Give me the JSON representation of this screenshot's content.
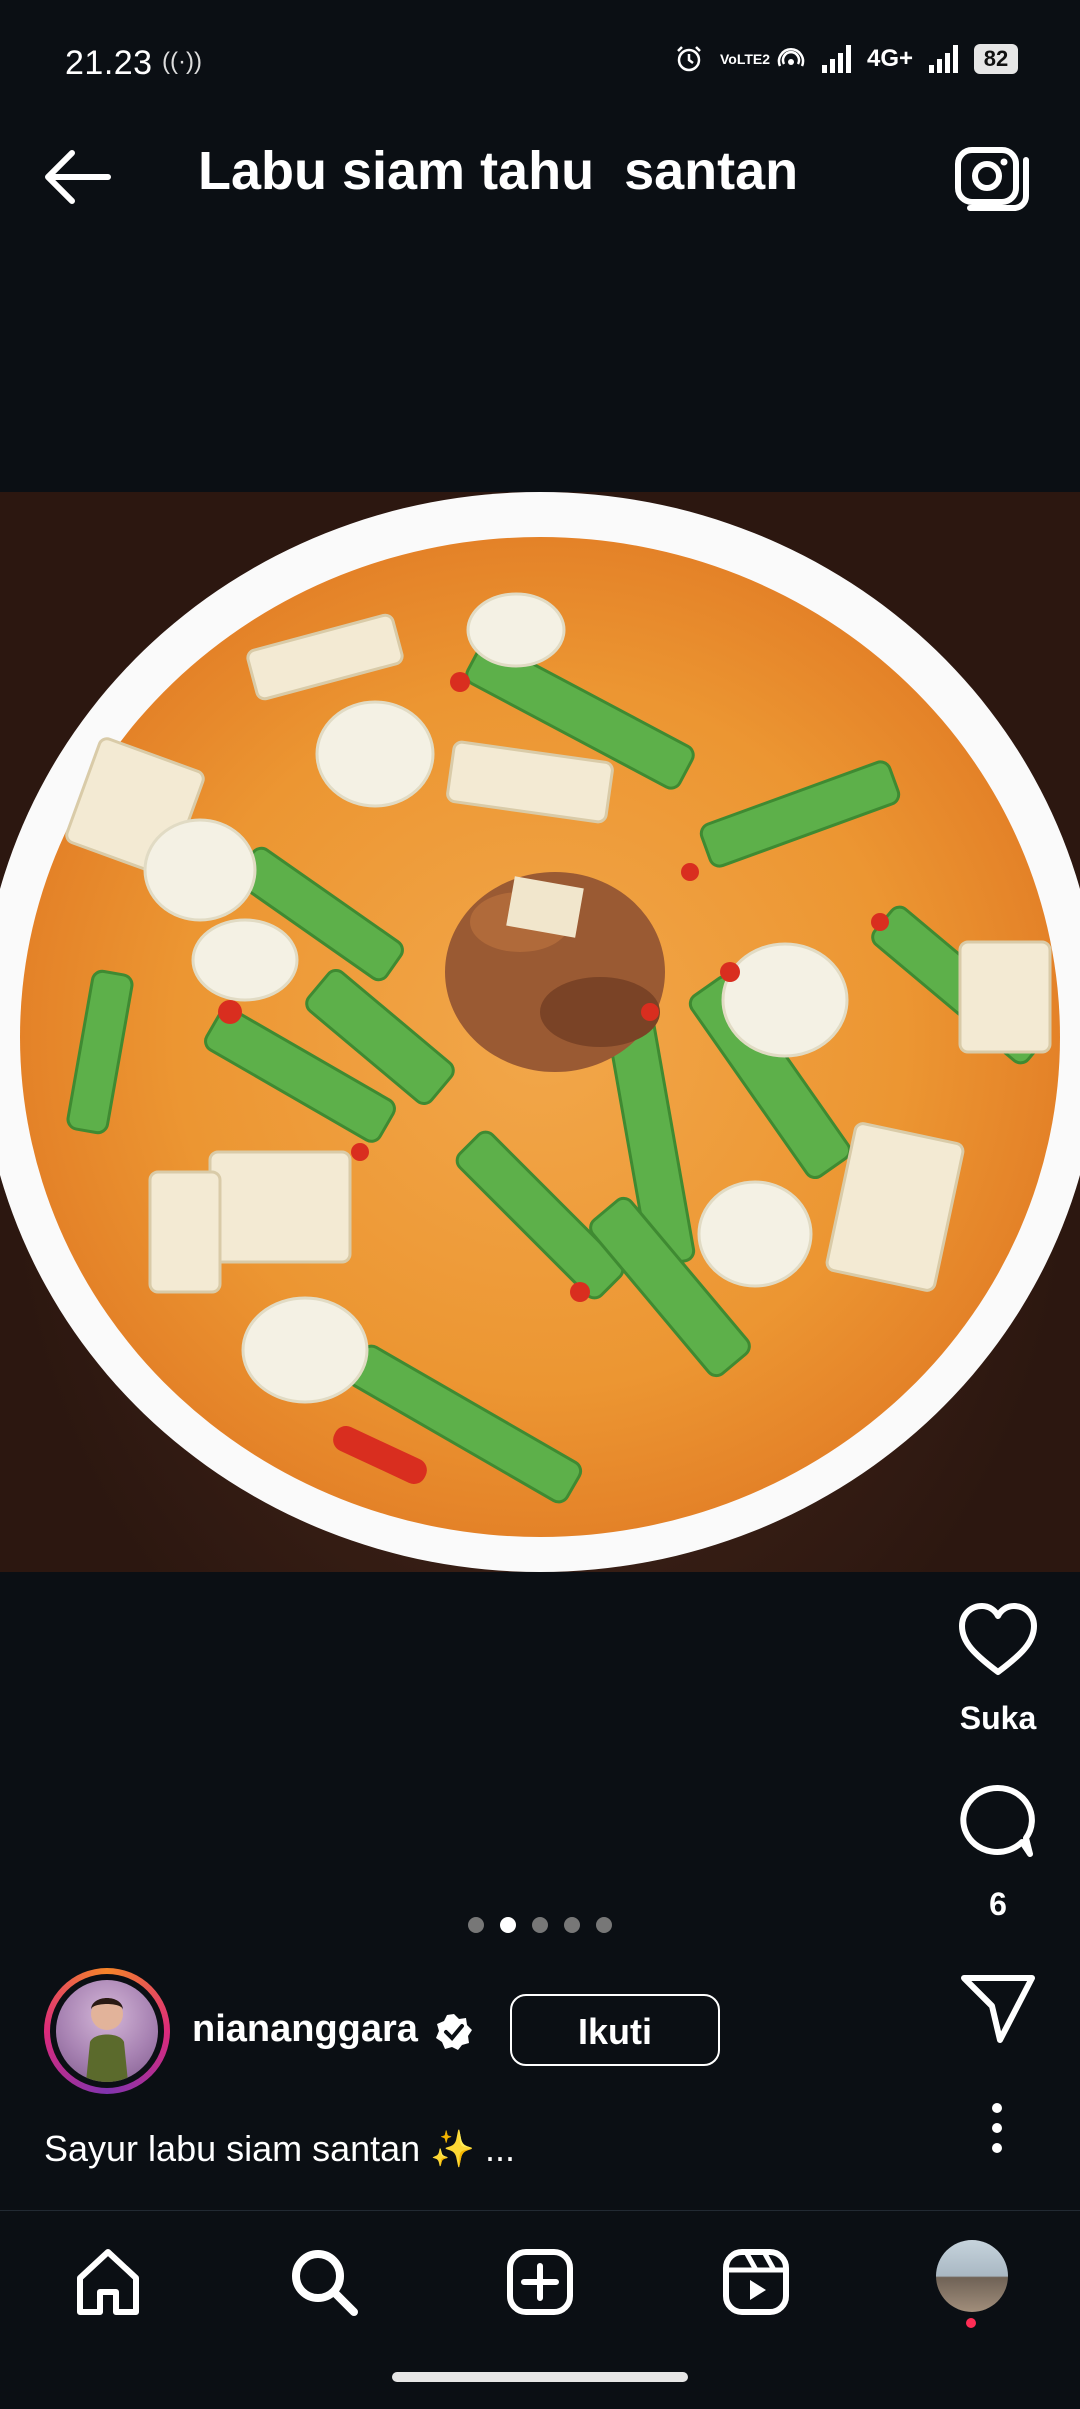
{
  "status_bar": {
    "time": "21.23",
    "radio_indicator": "((·))",
    "lte_label": "VoLTE2",
    "network": "4G+",
    "battery": "82"
  },
  "header": {
    "title": "Labu siam tahu  santan",
    "back_icon": "arrow-left-icon",
    "camera_icon": "camera-icon"
  },
  "actions": {
    "like_label": "Suka",
    "comment_count": "6"
  },
  "carousel": {
    "total": 5,
    "active": 2
  },
  "post": {
    "username": "niananggara",
    "follow_label": "Ikuti",
    "caption": "Sayur labu siam santan ✨ ..."
  },
  "colors": {
    "background": "#0b0f14",
    "story_ring": "#dd2a7b"
  }
}
